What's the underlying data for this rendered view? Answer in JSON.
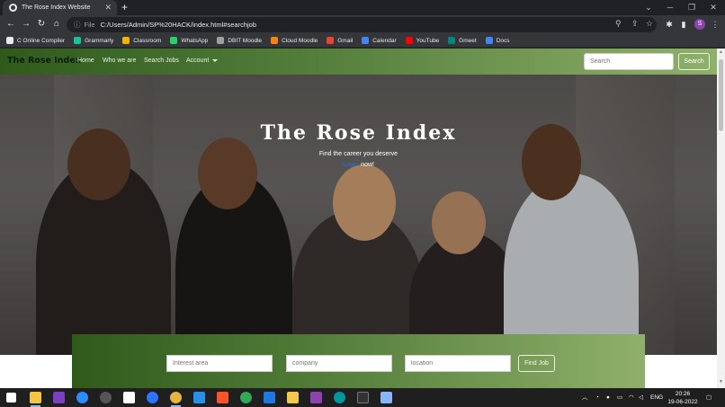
{
  "browser": {
    "tab_title": "The Rose Index Website",
    "tab_close": "✕",
    "new_tab": "+",
    "url_scheme_label": "File",
    "url": "C:/Users/Admin/SP%20HACK/index.html#searchjob",
    "profile_initial": "S"
  },
  "bookmarks": [
    {
      "label": "C Online Compiler",
      "color": "#e8eaed"
    },
    {
      "label": "Grammarly",
      "color": "#15c39a"
    },
    {
      "label": "Classroom",
      "color": "#f4b400"
    },
    {
      "label": "WhatsApp",
      "color": "#25d366"
    },
    {
      "label": "DBIT Moodle",
      "color": "#9e9e9e"
    },
    {
      "label": "Cloud Moodle",
      "color": "#f98012"
    },
    {
      "label": "Gmail",
      "color": "#ea4335"
    },
    {
      "label": "Calendar",
      "color": "#4285f4"
    },
    {
      "label": "YouTube",
      "color": "#ff0000"
    },
    {
      "label": "Gmeet",
      "color": "#00897b"
    },
    {
      "label": "Docs",
      "color": "#4285f4"
    }
  ],
  "navbar": {
    "brand": "The Rose Index",
    "links": [
      "Home",
      "Who we are",
      "Search Jobs",
      "Account"
    ],
    "search_placeholder": "Search",
    "search_button": "Search"
  },
  "hero": {
    "title": "The Rose Index",
    "subtitle": "Find the career you deserve",
    "login_link": "Login",
    "cta_suffix": "now!"
  },
  "find_job": {
    "interest_placeholder": "Interest area",
    "company_placeholder": "company",
    "location_placeholder": "location",
    "button": "Find Job"
  },
  "taskbar": {
    "lang": "ENG",
    "time": "20:26",
    "date": "19-06-2022"
  },
  "colors": {
    "nav_dark": "#2f5a1c",
    "nav_light": "#8fb06b",
    "login_link": "#1a73e8"
  }
}
